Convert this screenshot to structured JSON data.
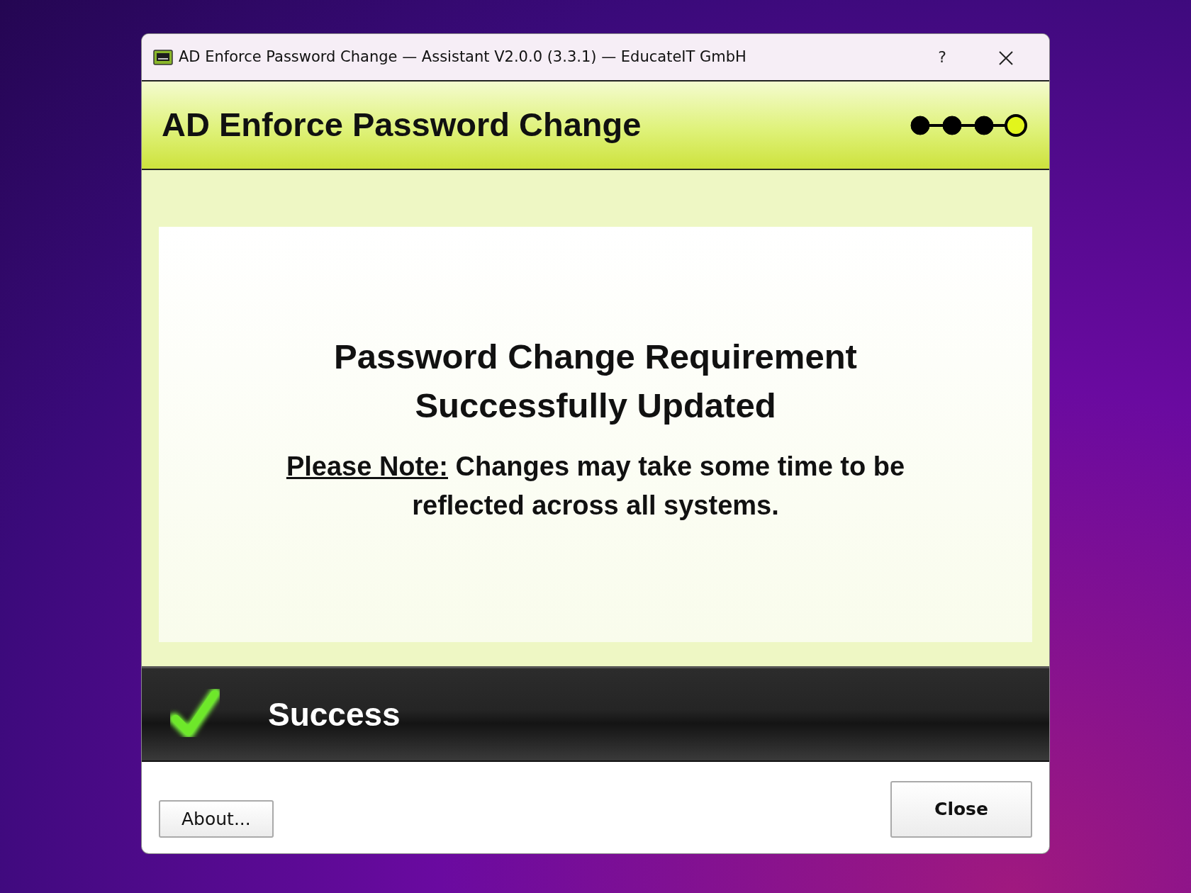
{
  "window": {
    "title": "AD Enforce Password Change — Assistant V2.0.0 (3.3.1) — EducateIT GmbH",
    "controls": [
      "?"
    ]
  },
  "header": {
    "title": "AD Enforce Password Change",
    "steps": [
      {
        "selected": false
      },
      {
        "selected": false
      },
      {
        "selected": false
      },
      {
        "selected": true
      }
    ]
  },
  "message": {
    "heading": "Password Change Requirement Successfully Updated",
    "note_label": "Please Note:",
    "note_text": "Changes may take some time to be reflected across all systems."
  },
  "status": {
    "kind": "success",
    "text": "Success"
  },
  "buttons": [
    {
      "label": "About...",
      "kind": "secondary"
    },
    {
      "label": "Close",
      "kind": "primary"
    }
  ]
}
